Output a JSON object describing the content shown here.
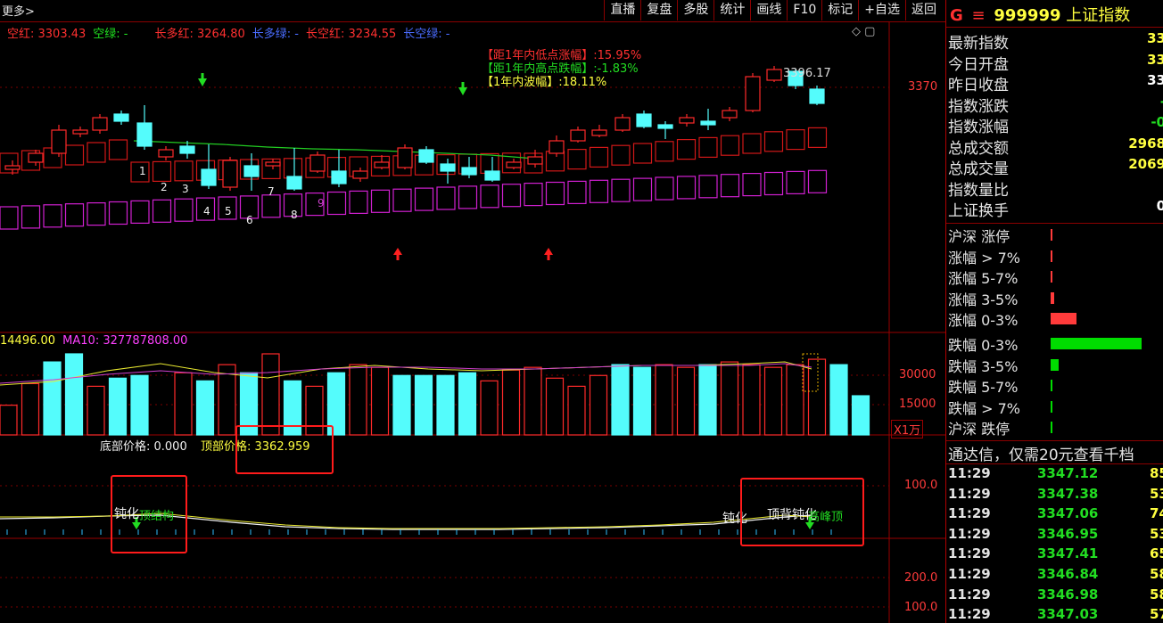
{
  "toolbar": {
    "more_label": "更多>",
    "buttons": [
      "直播",
      "复盘",
      "多股",
      "统计",
      "画线",
      "F10",
      "标记",
      "+自选",
      "返回"
    ]
  },
  "main_legend": [
    {
      "text": "空红: 3303.43",
      "color": "#ff3030"
    },
    {
      "text": "空绿: -",
      "color": "#20e020"
    },
    {
      "text": "长多红: 3264.80",
      "color": "#ff3030"
    },
    {
      "text": "长多绿: -",
      "color": "#4a6cff"
    },
    {
      "text": "长空红: 3234.55",
      "color": "#ff3030"
    },
    {
      "text": "长空绿: -",
      "color": "#4a6cff"
    }
  ],
  "stats": {
    "low_up": "【距1年内低点涨幅】:15.95%",
    "high_down": "【距1年内高点跌幅】:-1.83%",
    "range": "【1年内波幅】:18.11%"
  },
  "price_high_label": "3396.17",
  "main_axis": {
    "label": "3370"
  },
  "wave_numbers": [
    "1",
    "2",
    "3",
    "4",
    "5",
    "6",
    "7",
    "8",
    "9"
  ],
  "volume": {
    "legend_vol": "14496.00",
    "legend_ma10": "MA10: 327787808.00",
    "axis": [
      "30000",
      "15000"
    ],
    "unit": "X1万",
    "values": [
      11000,
      19000,
      27000,
      30000,
      18000,
      21000,
      22000,
      0,
      23000,
      20000,
      26000,
      23000,
      30000,
      20000,
      18000,
      23000,
      26000,
      25000,
      22000,
      22000,
      22000,
      23000,
      20000,
      24000,
      25000,
      21000,
      18000,
      22000,
      26000,
      25000,
      26000,
      25000,
      26000,
      27000,
      26000,
      25000,
      26000,
      28000,
      26000,
      14496
    ],
    "cyan": [
      false,
      false,
      true,
      true,
      false,
      true,
      true,
      false,
      false,
      true,
      false,
      true,
      false,
      true,
      false,
      true,
      false,
      false,
      true,
      true,
      true,
      true,
      false,
      false,
      false,
      false,
      false,
      false,
      true,
      true,
      false,
      false,
      true,
      false,
      false,
      false,
      false,
      false,
      true,
      true
    ]
  },
  "indicator": {
    "bottom_price": "底部价格: 0.000",
    "top_price": "顶部价格: 3362.959",
    "axis_top": "100.0",
    "signal_left_1": "钝化",
    "signal_left_2": "顶结构",
    "signal_right_1": "钝化",
    "signal_right_2": "顶背钝化",
    "signal_right_3": "高峰顶"
  },
  "lower_axis": [
    "200.0",
    "100.0"
  ],
  "quote": {
    "badge": "G",
    "code": "999999",
    "name": "上证指数",
    "rows": [
      {
        "label": "最新指数",
        "value": "33"
      },
      {
        "label": "今日开盘",
        "value": "33"
      },
      {
        "label": "昨日收盘",
        "value": "33"
      },
      {
        "label": "指数涨跌",
        "value": "-"
      },
      {
        "label": "指数涨幅",
        "value": "-0"
      },
      {
        "label": "总成交额",
        "value": "2968"
      },
      {
        "label": "总成交量",
        "value": "2069"
      },
      {
        "label": "指数量比",
        "value": ""
      },
      {
        "label": "上证换手",
        "value": "0"
      }
    ]
  },
  "breadth": [
    {
      "label": "沪深 涨停",
      "bar": 0.01,
      "color": "#ff3b3b"
    },
    {
      "label": "涨幅 > 7%",
      "bar": 0.01,
      "color": "#ff3b3b"
    },
    {
      "label": "涨幅 5-7%",
      "bar": 0.01,
      "color": "#ff3b3b"
    },
    {
      "label": "涨幅 3-5%",
      "bar": 0.04,
      "color": "#ff3b3b"
    },
    {
      "label": "涨幅 0-3%",
      "bar": 0.28,
      "color": "#ff3b3b"
    },
    {
      "label": "跌幅 0-3%",
      "bar": 1.0,
      "color": "#00dd00"
    },
    {
      "label": "跌幅 3-5%",
      "bar": 0.09,
      "color": "#00dd00"
    },
    {
      "label": "跌幅 5-7%",
      "bar": 0.01,
      "color": "#00dd00"
    },
    {
      "label": "跌幅 > 7%",
      "bar": 0.01,
      "color": "#00dd00"
    },
    {
      "label": "沪深 跌停",
      "bar": 0.01,
      "color": "#00dd00"
    }
  ],
  "promo": "通达信，仅需20元查看千档",
  "ticks": [
    {
      "time": "11:29",
      "price": "3347.12",
      "vol": "85"
    },
    {
      "time": "11:29",
      "price": "3347.38",
      "vol": "53"
    },
    {
      "time": "11:29",
      "price": "3347.06",
      "vol": "74"
    },
    {
      "time": "11:29",
      "price": "3346.95",
      "vol": "53"
    },
    {
      "time": "11:29",
      "price": "3347.41",
      "vol": "65"
    },
    {
      "time": "11:29",
      "price": "3346.84",
      "vol": "58"
    },
    {
      "time": "11:29",
      "price": "3346.98",
      "vol": "58"
    },
    {
      "time": "11:29",
      "price": "3347.03",
      "vol": "57"
    }
  ],
  "colors": {
    "up_red": "#ff2a2a",
    "down_cyan": "#54fcfc",
    "magenta": "#d020d0",
    "green": "#00dd00",
    "yellow": "#ffff40"
  }
}
